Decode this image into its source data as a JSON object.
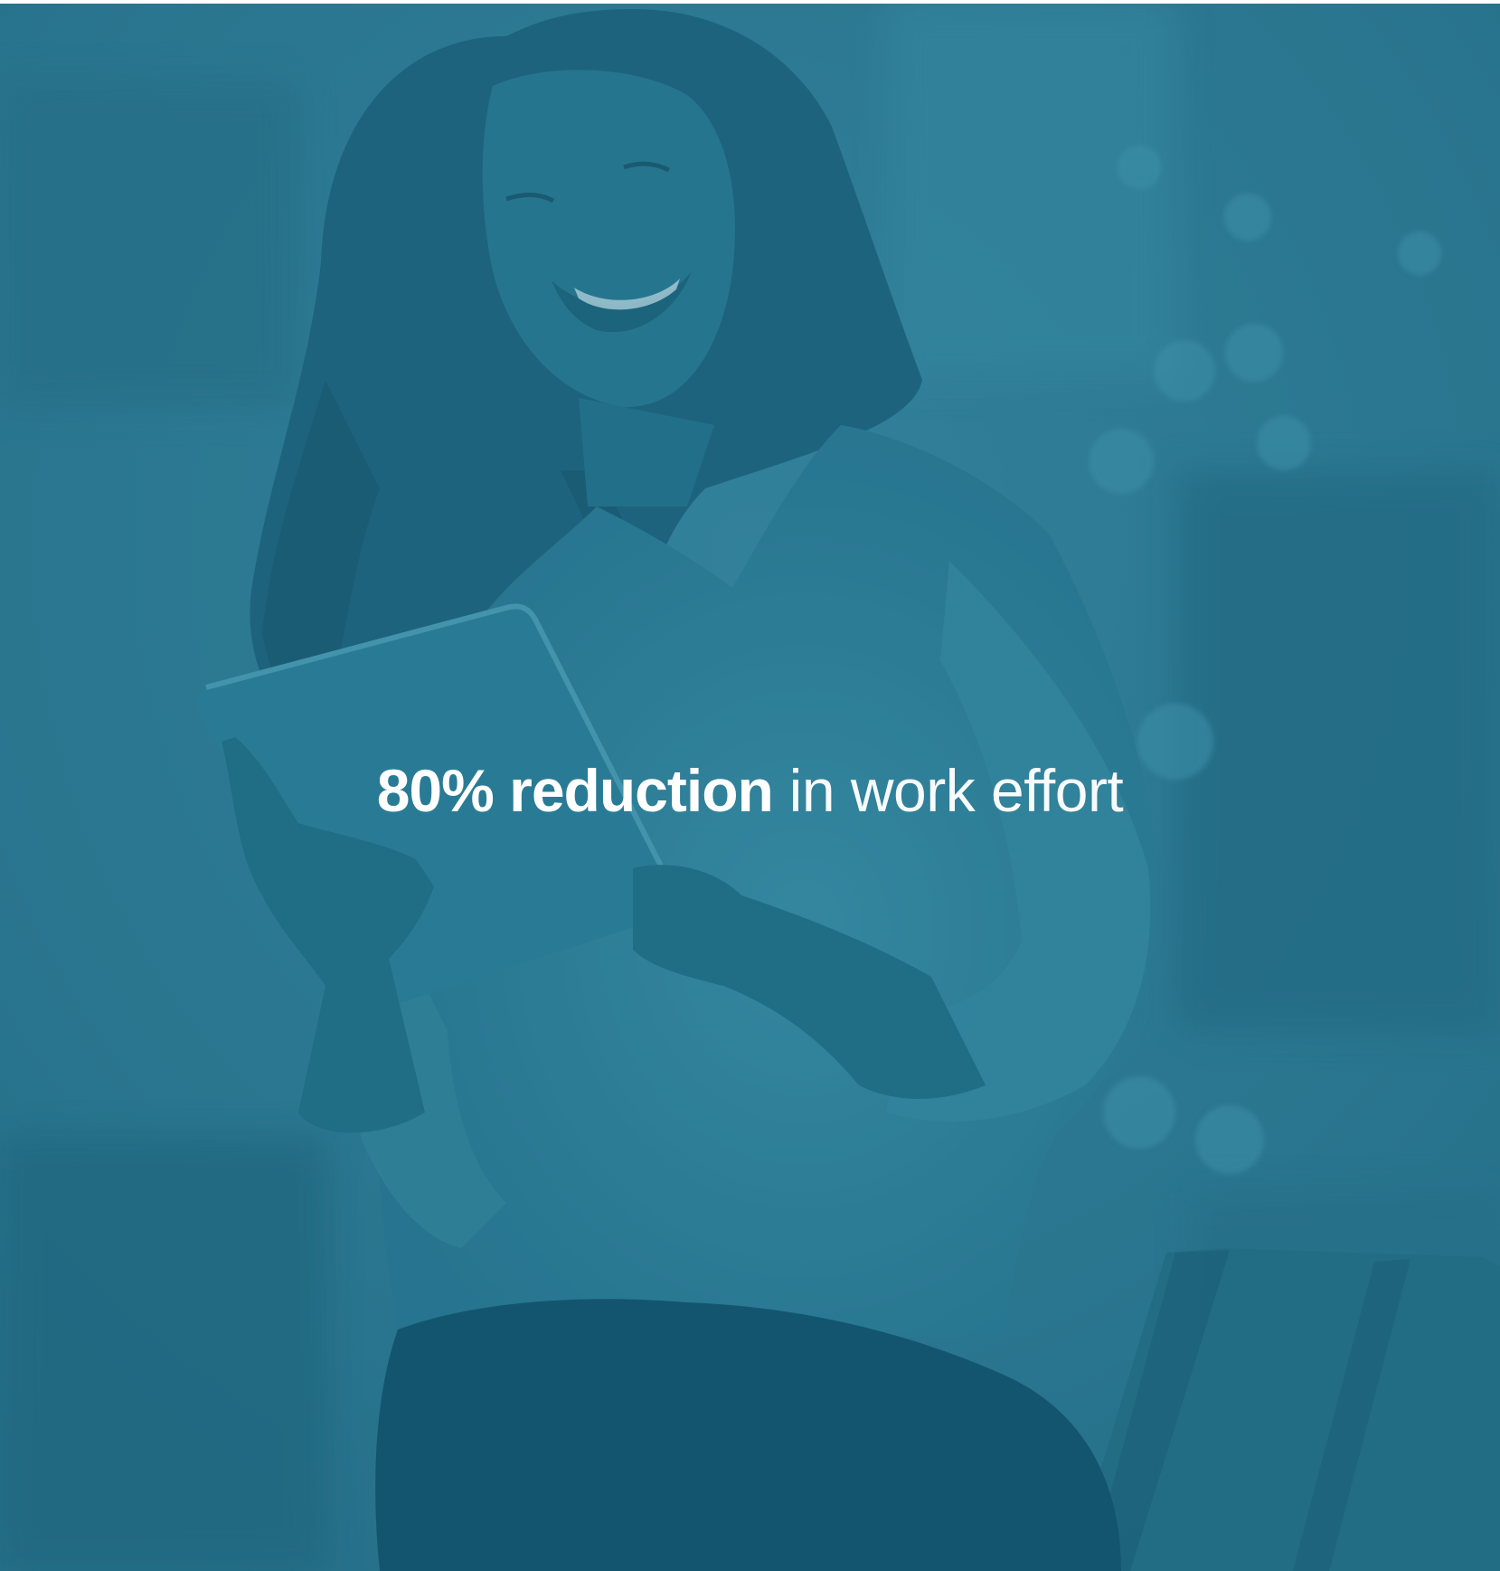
{
  "image": {
    "subject": "smiling-woman-holding-tablet",
    "overlay_color": "#2f7b92"
  },
  "headline": {
    "emphasis": "80% reduction",
    "rest": " in work effort",
    "text_color": "#ffffff"
  }
}
